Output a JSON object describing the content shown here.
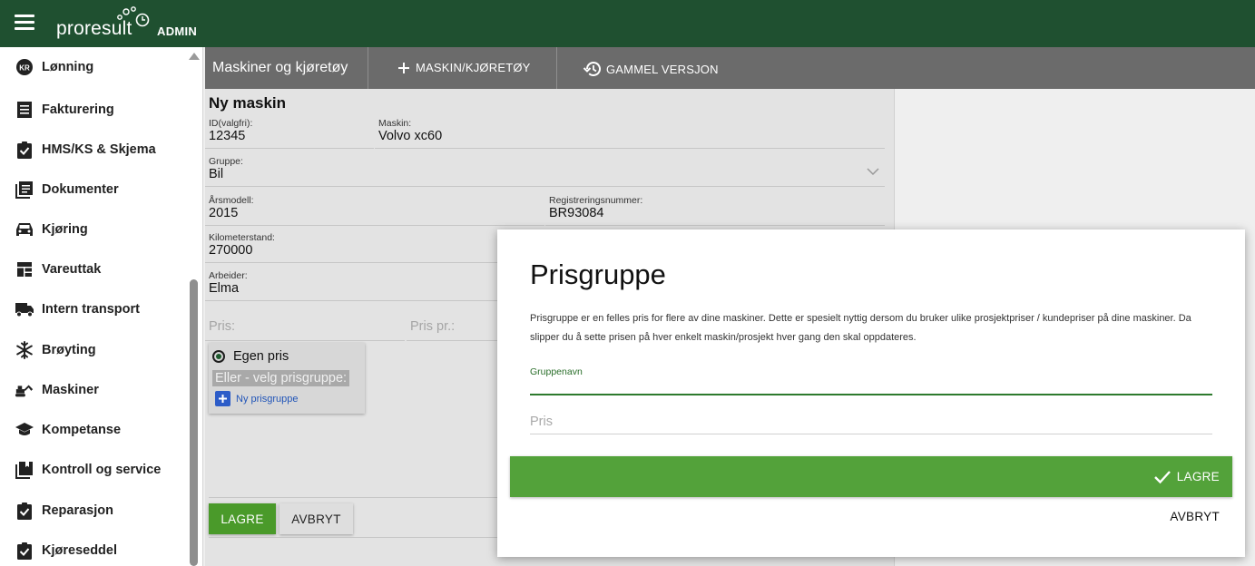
{
  "app": {
    "brand": "proresult",
    "brand_suffix": "ADMIN",
    "accent_color": "#1f5030"
  },
  "sidebar": {
    "items": [
      {
        "label": "Lønning",
        "icon": "kr-coin-icon"
      },
      {
        "label": "Fakturering",
        "icon": "invoice-icon"
      },
      {
        "label": "HMS/KS & Skjema",
        "icon": "clipboard-check-icon"
      },
      {
        "label": "Dokumenter",
        "icon": "documents-icon"
      },
      {
        "label": "Kjøring",
        "icon": "car-icon"
      },
      {
        "label": "Vareuttak",
        "icon": "dashboard-grid-icon"
      },
      {
        "label": "Intern transport",
        "icon": "truck-icon"
      },
      {
        "label": "Brøyting",
        "icon": "snowflake-icon"
      },
      {
        "label": "Maskiner",
        "icon": "excavator-icon"
      },
      {
        "label": "Kompetanse",
        "icon": "graduation-cap-icon"
      },
      {
        "label": "Kontroll og service",
        "icon": "library-books-icon"
      },
      {
        "label": "Reparasjon",
        "icon": "clipboard-check-icon"
      },
      {
        "label": "Kjøreseddel",
        "icon": "clipboard-check-icon"
      }
    ]
  },
  "header": {
    "title": "Maskiner og kjøretøy",
    "add_button": "MASKIN/KJØRETØY",
    "old_version_button": "GAMMEL VERSJON"
  },
  "form": {
    "title": "Ny maskin",
    "fields": {
      "id": {
        "label": "ID(valgfri):",
        "value": "12345"
      },
      "machine": {
        "label": "Maskin:",
        "value": "Volvo xc60"
      },
      "group": {
        "label": "Gruppe:",
        "value": "Bil"
      },
      "year": {
        "label": "Årsmodell:",
        "value": "2015"
      },
      "registration": {
        "label": "Registreringsnummer:",
        "value": "BR93084"
      },
      "mileage": {
        "label": "Kilometerstand:",
        "value": "270000"
      },
      "worker": {
        "label": "Arbeider:",
        "value": "Elma"
      },
      "price": {
        "placeholder": "Pris:"
      },
      "price_per": {
        "placeholder": "Pris pr.:"
      }
    },
    "price_options": {
      "own_price": "Egen pris",
      "or_choose": "Eller - velg prisgruppe:",
      "new_group": "Ny prisgruppe"
    },
    "save": "LAGRE",
    "cancel": "AVBRYT"
  },
  "dialog": {
    "title": "Prisgruppe",
    "description": "Prisgruppe er en felles pris for flere av dine maskiner. Dette er spesielt nyttig dersom du bruker ulike prosjektpriser / kundepriser på dine maskiner. Da slipper du å sette prisen på hver enkelt maskin/prosjekt hver gang den skal oppdateres.",
    "group_name_label": "Gruppenavn",
    "group_name_value": "",
    "price_placeholder": "Pris",
    "save": "LAGRE",
    "cancel": "AVBRYT"
  }
}
